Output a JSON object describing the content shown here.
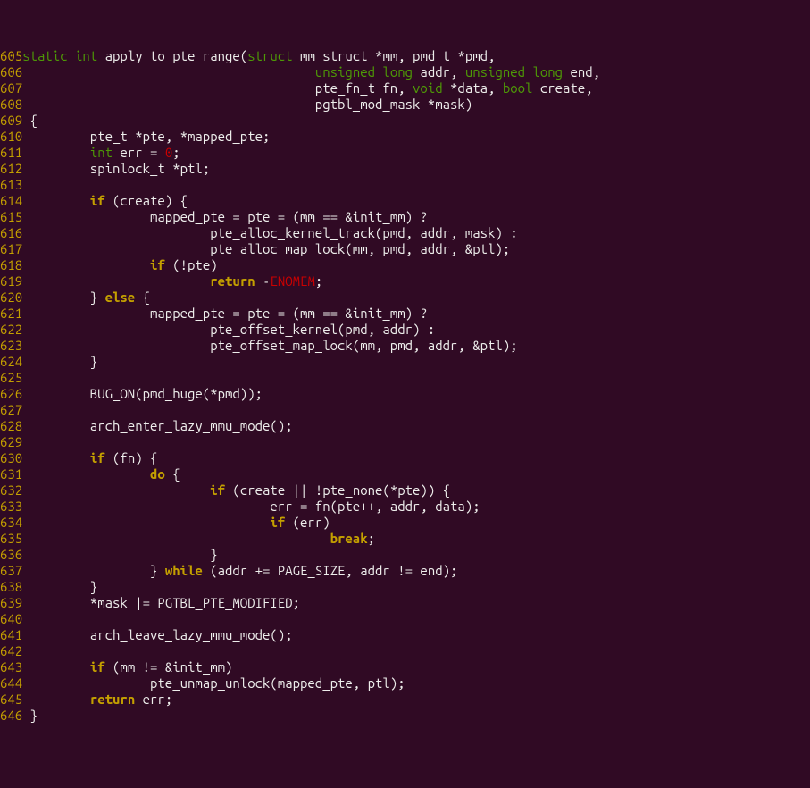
{
  "code_lines": [
    {
      "no": "605",
      "seg": [
        [
          "kw-storage",
          "static"
        ],
        [
          "",
          ". "
        ],
        [
          "kw-storage",
          "int"
        ],
        [
          "",
          ". apply_to_pte_range("
        ],
        [
          "kw-storage",
          "struct"
        ],
        [
          "",
          ". mm_struct *mm, pmd_t *pmd,"
        ]
      ]
    },
    {
      "no": "606",
      "seg": [
        [
          "",
          ".                                       "
        ],
        [
          "kw-storage",
          "unsigned"
        ],
        [
          "",
          ". "
        ],
        [
          "kw-storage",
          "long"
        ],
        [
          "",
          ". addr, "
        ],
        [
          "kw-storage",
          "unsigned"
        ],
        [
          "",
          ". "
        ],
        [
          "kw-storage",
          "long"
        ],
        [
          "",
          ". end,"
        ]
      ]
    },
    {
      "no": "607",
      "seg": [
        [
          "",
          ".                                       pte_fn_t fn, "
        ],
        [
          "kw-storage",
          "void"
        ],
        [
          "",
          ". *data, "
        ],
        [
          "kw-storage",
          "bool"
        ],
        [
          "",
          ". create,"
        ]
      ]
    },
    {
      "no": "608",
      "seg": [
        [
          "",
          ".                                       pgtbl_mod_mask *mask)"
        ]
      ]
    },
    {
      "no": "609",
      "seg": [
        [
          "",
          ". {"
        ]
      ]
    },
    {
      "no": "610",
      "seg": [
        [
          "",
          ".         pte_t *pte, *mapped_pte;"
        ]
      ]
    },
    {
      "no": "611",
      "seg": [
        [
          "",
          ".         "
        ],
        [
          "kw-storage",
          "int"
        ],
        [
          "",
          ". err = "
        ],
        [
          "num-red",
          "0"
        ],
        [
          "",
          ".;"
        ]
      ]
    },
    {
      "no": "612",
      "seg": [
        [
          "",
          ".         spinlock_t *ptl;"
        ]
      ]
    },
    {
      "no": "613",
      "seg": [
        [
          "",
          "."
        ]
      ]
    },
    {
      "no": "614",
      "seg": [
        [
          "",
          ".         "
        ],
        [
          "kw-control",
          "if"
        ],
        [
          "",
          ". (create) {"
        ]
      ]
    },
    {
      "no": "615",
      "seg": [
        [
          "",
          ".                 mapped_pte = pte = (mm == &init_mm) ?"
        ]
      ]
    },
    {
      "no": "616",
      "seg": [
        [
          "",
          ".                         pte_alloc_kernel_track(pmd, addr, mask) :"
        ]
      ]
    },
    {
      "no": "617",
      "seg": [
        [
          "",
          ".                         pte_alloc_map_lock(mm, pmd, addr, &ptl);"
        ]
      ]
    },
    {
      "no": "618",
      "seg": [
        [
          "",
          ".                 "
        ],
        [
          "kw-control",
          "if"
        ],
        [
          "",
          ". (!pte)"
        ]
      ]
    },
    {
      "no": "619",
      "seg": [
        [
          "",
          ".                         "
        ],
        [
          "kw-control",
          "return"
        ],
        [
          "",
          ". -"
        ],
        [
          "err-red",
          "ENOMEM"
        ],
        [
          "",
          ".;"
        ]
      ]
    },
    {
      "no": "620",
      "seg": [
        [
          "",
          ".         } "
        ],
        [
          "kw-control",
          "else"
        ],
        [
          "",
          ". {"
        ]
      ]
    },
    {
      "no": "621",
      "seg": [
        [
          "",
          ".                 mapped_pte = pte = (mm == &init_mm) ?"
        ]
      ]
    },
    {
      "no": "622",
      "seg": [
        [
          "",
          ".                         pte_offset_kernel(pmd, addr) :"
        ]
      ]
    },
    {
      "no": "623",
      "seg": [
        [
          "",
          ".                         pte_offset_map_lock(mm, pmd, addr, &ptl);"
        ]
      ]
    },
    {
      "no": "624",
      "seg": [
        [
          "",
          ".         }"
        ]
      ]
    },
    {
      "no": "625",
      "seg": [
        [
          "",
          "."
        ]
      ]
    },
    {
      "no": "626",
      "seg": [
        [
          "",
          ".         BUG_ON(pmd_huge(*pmd));"
        ]
      ]
    },
    {
      "no": "627",
      "seg": [
        [
          "",
          "."
        ]
      ]
    },
    {
      "no": "628",
      "seg": [
        [
          "",
          ".         arch_enter_lazy_mmu_mode();"
        ]
      ]
    },
    {
      "no": "629",
      "seg": [
        [
          "",
          "."
        ]
      ]
    },
    {
      "no": "630",
      "seg": [
        [
          "",
          ".         "
        ],
        [
          "kw-control",
          "if"
        ],
        [
          "",
          ". (fn) {"
        ]
      ]
    },
    {
      "no": "631",
      "seg": [
        [
          "",
          ".                 "
        ],
        [
          "kw-control",
          "do"
        ],
        [
          "",
          ". {"
        ]
      ]
    },
    {
      "no": "632",
      "seg": [
        [
          "",
          ".                         "
        ],
        [
          "kw-control",
          "if"
        ],
        [
          "",
          ". (create || !pte_none(*pte)) {"
        ]
      ]
    },
    {
      "no": "633",
      "seg": [
        [
          "",
          ".                                 err = fn(pte++, addr, data);"
        ]
      ]
    },
    {
      "no": "634",
      "seg": [
        [
          "",
          ".                                 "
        ],
        [
          "kw-control",
          "if"
        ],
        [
          "",
          ". (err)"
        ]
      ]
    },
    {
      "no": "635",
      "seg": [
        [
          "",
          ".                                         "
        ],
        [
          "kw-control",
          "break"
        ],
        [
          "",
          ".;"
        ]
      ]
    },
    {
      "no": "636",
      "seg": [
        [
          "",
          ".                         }"
        ]
      ]
    },
    {
      "no": "637",
      "seg": [
        [
          "",
          ".                 } "
        ],
        [
          "kw-control",
          "while"
        ],
        [
          "",
          ". (addr += PAGE_SIZE, addr != end);"
        ]
      ]
    },
    {
      "no": "638",
      "seg": [
        [
          "",
          ".         }"
        ]
      ]
    },
    {
      "no": "639",
      "seg": [
        [
          "",
          ".         *mask |= PGTBL_PTE_MODIFIED;"
        ]
      ]
    },
    {
      "no": "640",
      "seg": [
        [
          "",
          "."
        ]
      ]
    },
    {
      "no": "641",
      "seg": [
        [
          "",
          ".         arch_leave_lazy_mmu_mode();"
        ]
      ]
    },
    {
      "no": "642",
      "seg": [
        [
          "",
          "."
        ]
      ]
    },
    {
      "no": "643",
      "seg": [
        [
          "",
          ".         "
        ],
        [
          "kw-control",
          "if"
        ],
        [
          "",
          ". (mm != &init_mm)"
        ]
      ]
    },
    {
      "no": "644",
      "seg": [
        [
          "",
          ".                 pte_unmap_unlock(mapped_pte, ptl);"
        ]
      ]
    },
    {
      "no": "645",
      "seg": [
        [
          "",
          ".         "
        ],
        [
          "kw-control",
          "return"
        ],
        [
          "",
          ". err;"
        ]
      ]
    },
    {
      "no": "646",
      "seg": [
        [
          "",
          ". }"
        ]
      ]
    }
  ]
}
